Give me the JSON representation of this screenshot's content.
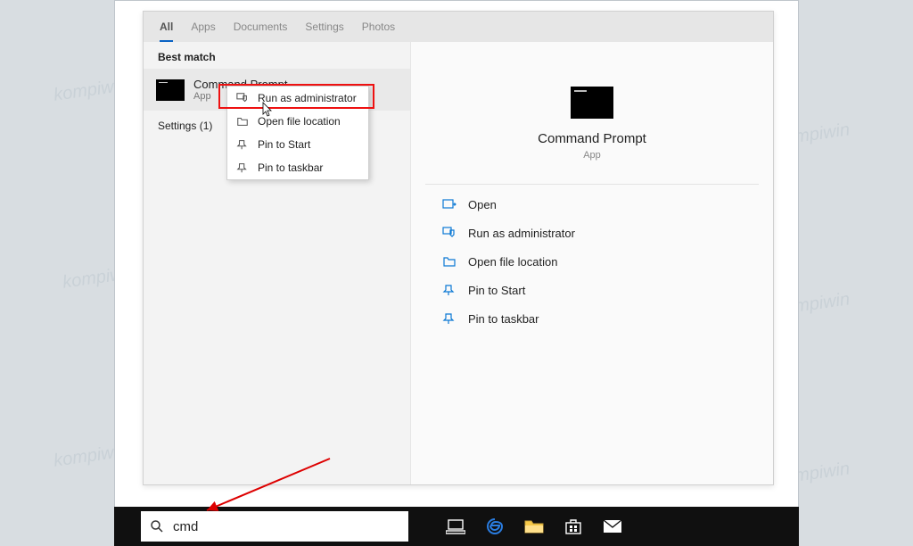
{
  "watermark": "kompiwin",
  "tabs": [
    "All",
    "Apps",
    "Documents",
    "Settings",
    "Photos"
  ],
  "best_match_label": "Best match",
  "best_match": {
    "title": "Command Prompt",
    "sub": "App"
  },
  "settings_label": "Settings (1)",
  "context_menu": {
    "run_admin": "Run as administrator",
    "open_loc": "Open file location",
    "pin_start": "Pin to Start",
    "pin_taskbar": "Pin to taskbar"
  },
  "preview": {
    "title": "Command Prompt",
    "sub": "App"
  },
  "actions": {
    "open": "Open",
    "run_admin": "Run as administrator",
    "open_loc": "Open file location",
    "pin_start": "Pin to Start",
    "pin_taskbar": "Pin to taskbar"
  },
  "search": {
    "value": "cmd"
  }
}
